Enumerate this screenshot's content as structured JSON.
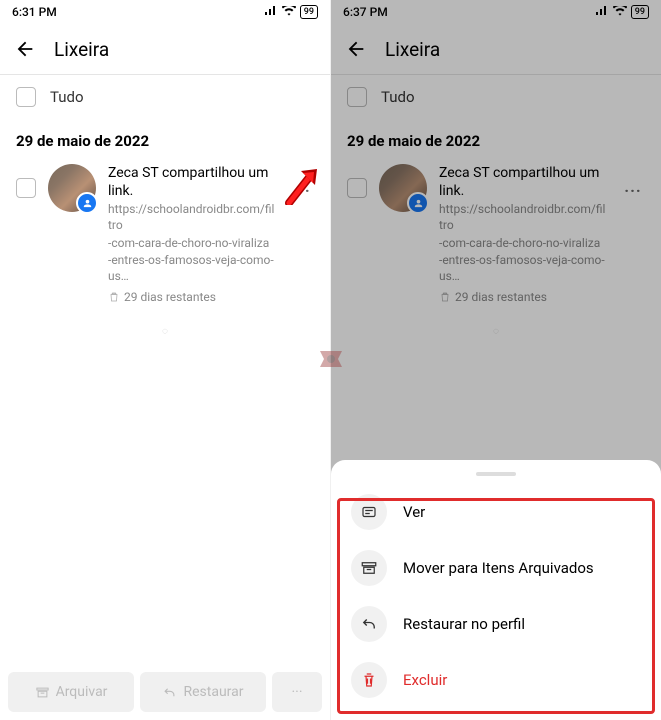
{
  "left": {
    "status": {
      "time": "6:31 PM",
      "battery": "99"
    },
    "header": {
      "title": "Lixeira"
    },
    "selectAll": {
      "label": "Tudo"
    },
    "dateHeader": "29 de maio de 2022",
    "item": {
      "title": "Zeca ST compartilhou um link.",
      "link1": "https://schoolandroidbr.com/filtro",
      "link2": "-com-cara-de-choro-no-viraliza",
      "link3": "-entres-os-famosos-veja-como-us…",
      "remaining": "29 dias restantes"
    },
    "bottom": {
      "archive": "Arquivar",
      "restore": "Restaurar"
    }
  },
  "right": {
    "status": {
      "time": "6:37 PM",
      "battery": "99"
    },
    "header": {
      "title": "Lixeira"
    },
    "selectAll": {
      "label": "Tudo"
    },
    "dateHeader": "29 de maio de 2022",
    "item": {
      "title": "Zeca ST compartilhou um link.",
      "link1": "https://schoolandroidbr.com/filtro",
      "link2": "-com-cara-de-choro-no-viraliza",
      "link3": "-entres-os-famosos-veja-como-us…",
      "remaining": "29 dias restantes"
    },
    "sheet": {
      "view": "Ver",
      "archive": "Mover para Itens Arquivados",
      "restore": "Restaurar no perfil",
      "delete": "Excluir"
    }
  }
}
